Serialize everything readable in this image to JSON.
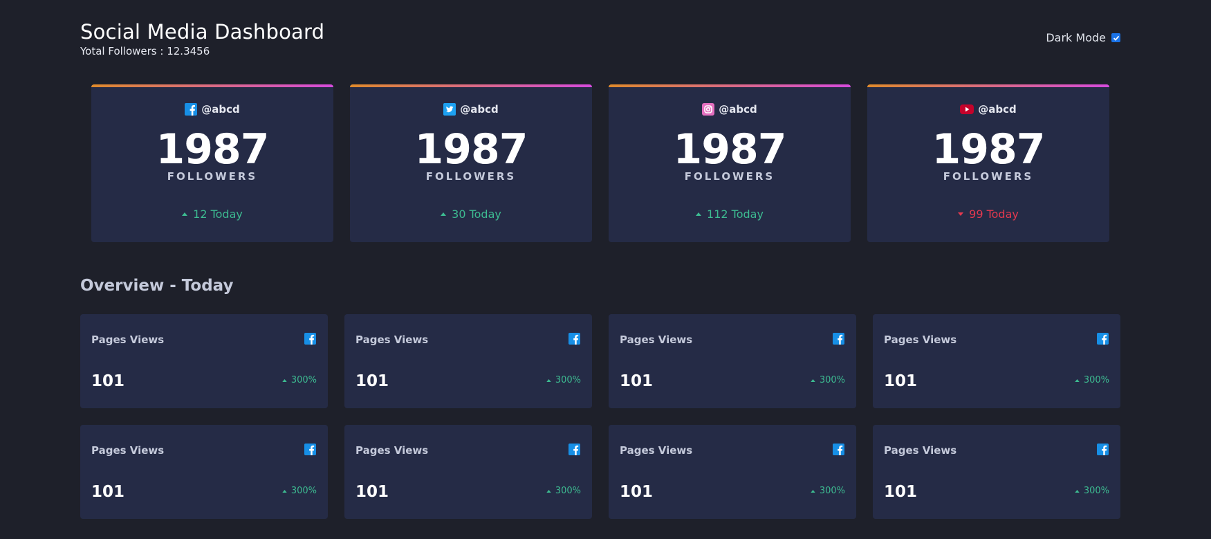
{
  "header": {
    "title": "Social Media Dashboard",
    "total_followers": "Yotal Followers : 12.3456",
    "dark_mode_label": "Dark Mode",
    "dark_mode_checked": true
  },
  "colors": {
    "background": "#1e202a",
    "card": "#252b46",
    "accent_gradient_start": "#df8a2b",
    "accent_gradient_end": "#d64bdc",
    "positive": "#3dbb91",
    "negative": "#e6394f",
    "facebook": "#178fe6",
    "twitter": "#1da1f2",
    "instagram": "#e46fbf",
    "youtube": "#c4032b"
  },
  "follower_cards": [
    {
      "platform": "facebook",
      "icon": "facebook-icon",
      "handle": "@abcd",
      "count": "1987",
      "label": "FOLLOWERS",
      "today": "12 Today",
      "trend": "up"
    },
    {
      "platform": "twitter",
      "icon": "twitter-icon",
      "handle": "@abcd",
      "count": "1987",
      "label": "FOLLOWERS",
      "today": "30 Today",
      "trend": "up"
    },
    {
      "platform": "instagram",
      "icon": "instagram-icon",
      "handle": "@abcd",
      "count": "1987",
      "label": "FOLLOWERS",
      "today": "112 Today",
      "trend": "up"
    },
    {
      "platform": "youtube",
      "icon": "youtube-icon",
      "handle": "@abcd",
      "count": "1987",
      "label": "FOLLOWERS",
      "today": "99 Today",
      "trend": "down"
    }
  ],
  "overview": {
    "title": "Overview - Today",
    "cards": [
      {
        "label": "Pages Views",
        "icon": "facebook-icon",
        "value": "101",
        "change": "300%",
        "trend": "up"
      },
      {
        "label": "Pages Views",
        "icon": "facebook-icon",
        "value": "101",
        "change": "300%",
        "trend": "up"
      },
      {
        "label": "Pages Views",
        "icon": "facebook-icon",
        "value": "101",
        "change": "300%",
        "trend": "up"
      },
      {
        "label": "Pages Views",
        "icon": "facebook-icon",
        "value": "101",
        "change": "300%",
        "trend": "up"
      },
      {
        "label": "Pages Views",
        "icon": "facebook-icon",
        "value": "101",
        "change": "300%",
        "trend": "up"
      },
      {
        "label": "Pages Views",
        "icon": "facebook-icon",
        "value": "101",
        "change": "300%",
        "trend": "up"
      },
      {
        "label": "Pages Views",
        "icon": "facebook-icon",
        "value": "101",
        "change": "300%",
        "trend": "up"
      },
      {
        "label": "Pages Views",
        "icon": "facebook-icon",
        "value": "101",
        "change": "300%",
        "trend": "up"
      }
    ]
  }
}
